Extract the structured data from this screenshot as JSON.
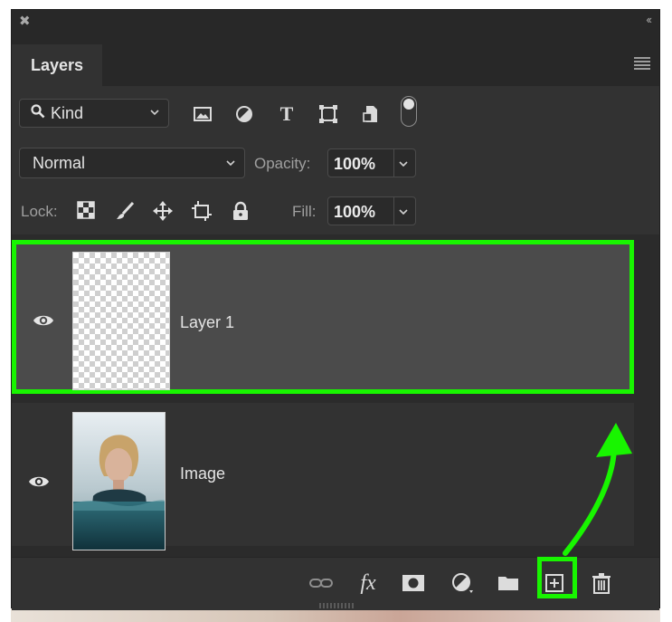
{
  "panel": {
    "tab_label": "Layers",
    "close_glyph": "✖",
    "collapse_glyph": "‹‹"
  },
  "filter": {
    "kind_label": "Kind",
    "icons": [
      "image-filter-icon",
      "adjustment-filter-icon",
      "type-filter-icon",
      "shape-filter-icon",
      "smart-object-filter-icon"
    ],
    "type_glyph": "T"
  },
  "blend": {
    "mode": "Normal",
    "opacity_label": "Opacity:",
    "opacity_value": "100%"
  },
  "lock": {
    "label": "Lock:",
    "icons": [
      "lock-transparent-icon",
      "lock-pixels-icon",
      "lock-position-icon",
      "lock-artboard-icon",
      "lock-all-icon"
    ],
    "fill_label": "Fill:",
    "fill_value": "100%"
  },
  "layers": [
    {
      "name": "Layer 1",
      "selected": true,
      "thumbnail": "transparent"
    },
    {
      "name": "Image",
      "selected": false,
      "thumbnail": "photo"
    }
  ],
  "footer": {
    "icons": [
      "link-layers-icon",
      "fx-icon",
      "add-mask-icon",
      "new-adjustment-icon",
      "new-group-icon",
      "new-layer-icon",
      "delete-layer-icon"
    ],
    "fx_label": "fx"
  },
  "colors": {
    "highlight": "#18f500",
    "panel_bg": "#323232",
    "selected_row": "#4b4b4b"
  }
}
